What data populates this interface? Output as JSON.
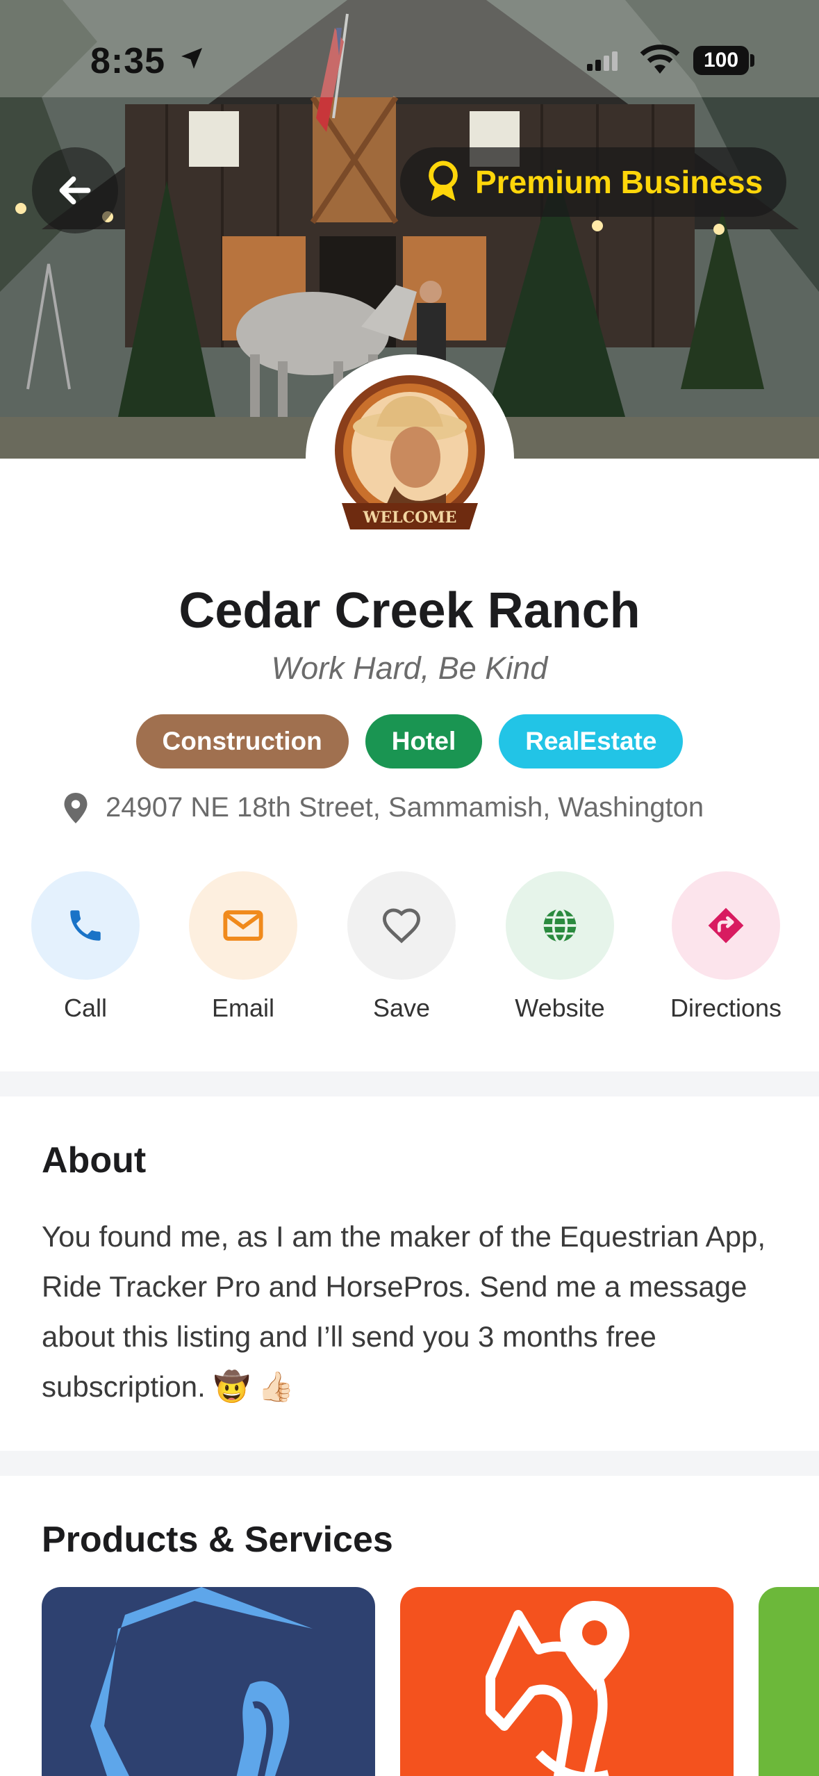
{
  "status_bar": {
    "time": "8:35",
    "battery": "100"
  },
  "header": {
    "badge_label": "Premium Business"
  },
  "business": {
    "name": "Cedar Creek Ranch",
    "tagline": "Work Hard, Be Kind",
    "avatar_banner": "WELCOME",
    "tags": [
      {
        "label": "Construction",
        "color": "#a0704f"
      },
      {
        "label": "Hotel",
        "color": "#1a9552"
      },
      {
        "label": "RealEstate",
        "color": "#22c4e6"
      }
    ],
    "address": "24907 NE 18th Street, Sammamish, Washington"
  },
  "actions": [
    {
      "label": "Call",
      "icon": "phone-icon",
      "bg": "#e4f1fd",
      "fg": "#1a73c7"
    },
    {
      "label": "Email",
      "icon": "mail-icon",
      "bg": "#fdefdf",
      "fg": "#f08a1c"
    },
    {
      "label": "Save",
      "icon": "heart-icon",
      "bg": "#f1f1f1",
      "fg": "#666666"
    },
    {
      "label": "Website",
      "icon": "globe-icon",
      "bg": "#e6f4ea",
      "fg": "#2a8a3e"
    },
    {
      "label": "Directions",
      "icon": "directions-icon",
      "bg": "#fce4ec",
      "fg": "#d81b60"
    }
  ],
  "about": {
    "title": "About",
    "text": "You found me, as I am the maker of the Equestrian App, Ride Tracker Pro and HorsePros. Send me a message about this listing and I’ll send you 3 months free subscription. 🤠 👍🏻"
  },
  "products": {
    "title": "Products & Services"
  },
  "colors": {
    "premium_gold": "#ffd60a",
    "divider": "#f4f5f7"
  }
}
